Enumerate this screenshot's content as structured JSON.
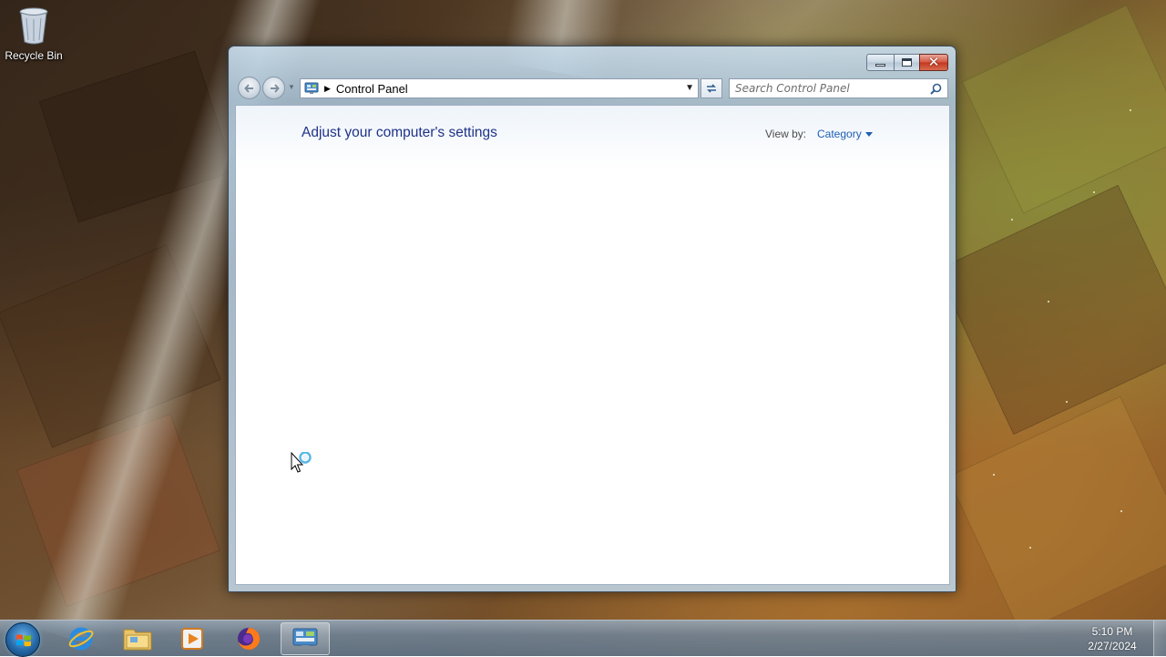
{
  "desktop": {
    "icons": [
      {
        "label": "Recycle Bin",
        "icon": "recycle-bin-icon"
      }
    ]
  },
  "window": {
    "title_buttons": {
      "minimize": "minimize-icon",
      "maximize": "maximize-icon",
      "close": "close-icon"
    },
    "address_bar": {
      "icon": "control-panel-icon",
      "breadcrumb": [
        "Control Panel"
      ]
    },
    "search": {
      "placeholder": "Search Control Panel",
      "value": ""
    },
    "content": {
      "title": "Adjust your computer's settings",
      "view_by_label": "View by:",
      "view_by_value": "Category"
    }
  },
  "taskbar": {
    "items": [
      {
        "name": "start-button",
        "icon": "windows-logo-icon"
      },
      {
        "name": "internet-explorer",
        "icon": "internet-explorer-icon"
      },
      {
        "name": "windows-explorer",
        "icon": "folder-icon"
      },
      {
        "name": "media-player",
        "icon": "media-player-icon"
      },
      {
        "name": "firefox",
        "icon": "firefox-icon"
      },
      {
        "name": "control-panel",
        "icon": "control-panel-icon",
        "active": true
      }
    ],
    "clock": {
      "time": "5:10 PM",
      "date": "2/27/2024"
    }
  },
  "colors": {
    "title_text": "#1e3287",
    "link": "#1e5fb4",
    "close_button": "#c2361f"
  }
}
